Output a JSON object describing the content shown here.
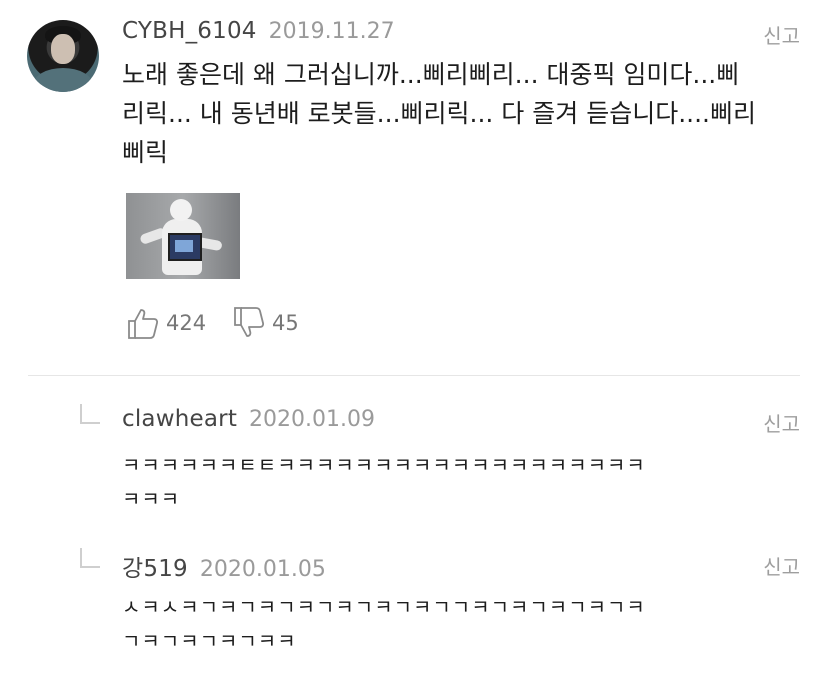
{
  "main": {
    "author": "CYBH_6104",
    "date": "2019.11.27",
    "report": "신고",
    "lines": [
      "노래 좋은데 왜 그러십니까...삐리삐리... 대중픽 임미다...삐",
      "리릭... 내 동년배 로봇들...삐리릭... 다 즐겨 듣습니다....삐리",
      "삐릭"
    ],
    "likes": "424",
    "dislikes": "45"
  },
  "replies": [
    {
      "author": "clawheart",
      "date": "2020.01.09",
      "report": "신고",
      "lines": [
        "ㅋㅋㅋㅋㅋㅋㅌㅌㅋㅋㅋㅋㅋㅋㅋㅋㅋㅋㅋㅋㅋㅋㅋㅋㅋㅋㅋ",
        "ㅋㅋㅋ"
      ]
    },
    {
      "author": "강519",
      "date": "2020.01.05",
      "report": "신고",
      "lines": [
        "ㅅㅋㅅㅋㄱㅋㄱㅋㄱㅋㄱㅋㄱㅋㄱㅋㄱㄱㅋㄱㅋㄱㅋㄱㅋㄱㅋ",
        "ㄱㅋㄱㅋㄱㅋㄱㅋㅋ"
      ]
    }
  ],
  "icons": {
    "like": "thumbs-up-icon",
    "dislike": "thumbs-down-icon",
    "reply": "reply-indent-icon"
  },
  "colors": {
    "text": "#1d1d1d",
    "muted": "#9a9a9a",
    "divider": "#e6e6e6"
  }
}
